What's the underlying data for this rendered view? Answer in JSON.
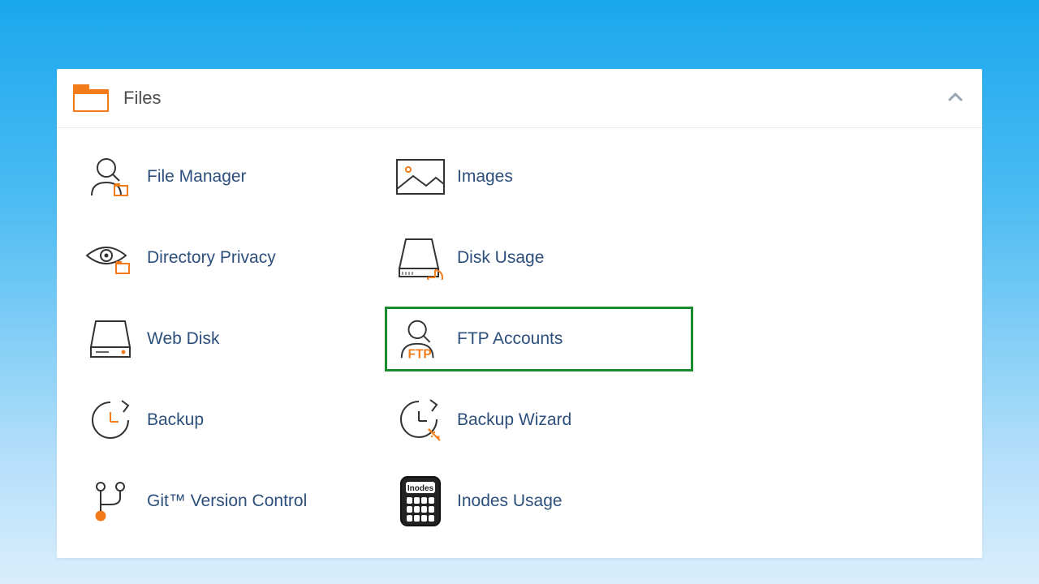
{
  "section": {
    "title": "Files",
    "items": [
      {
        "id": "file-manager",
        "label": "File Manager",
        "icon": "file-manager-icon",
        "col": 0,
        "selected": false
      },
      {
        "id": "images",
        "label": "Images",
        "icon": "images-icon",
        "col": 1,
        "selected": false
      },
      {
        "id": "directory-privacy",
        "label": "Directory Privacy",
        "icon": "directory-privacy-icon",
        "col": 0,
        "selected": false
      },
      {
        "id": "disk-usage",
        "label": "Disk Usage",
        "icon": "disk-usage-icon",
        "col": 1,
        "selected": false
      },
      {
        "id": "web-disk",
        "label": "Web Disk",
        "icon": "web-disk-icon",
        "col": 0,
        "selected": false
      },
      {
        "id": "ftp-accounts",
        "label": "FTP Accounts",
        "icon": "ftp-accounts-icon",
        "col": 1,
        "selected": true
      },
      {
        "id": "backup",
        "label": "Backup",
        "icon": "backup-icon",
        "col": 0,
        "selected": false
      },
      {
        "id": "backup-wizard",
        "label": "Backup Wizard",
        "icon": "backup-wizard-icon",
        "col": 1,
        "selected": false
      },
      {
        "id": "git-version-control",
        "label": "Git™ Version Control",
        "icon": "git-icon",
        "col": 0,
        "selected": false
      },
      {
        "id": "inodes-usage",
        "label": "Inodes Usage",
        "icon": "inodes-icon",
        "col": 1,
        "selected": false
      }
    ]
  },
  "colors": {
    "stroke": "#333333",
    "accent": "#f27b1a",
    "link": "#2c4f7c",
    "select": "#188c2c"
  }
}
